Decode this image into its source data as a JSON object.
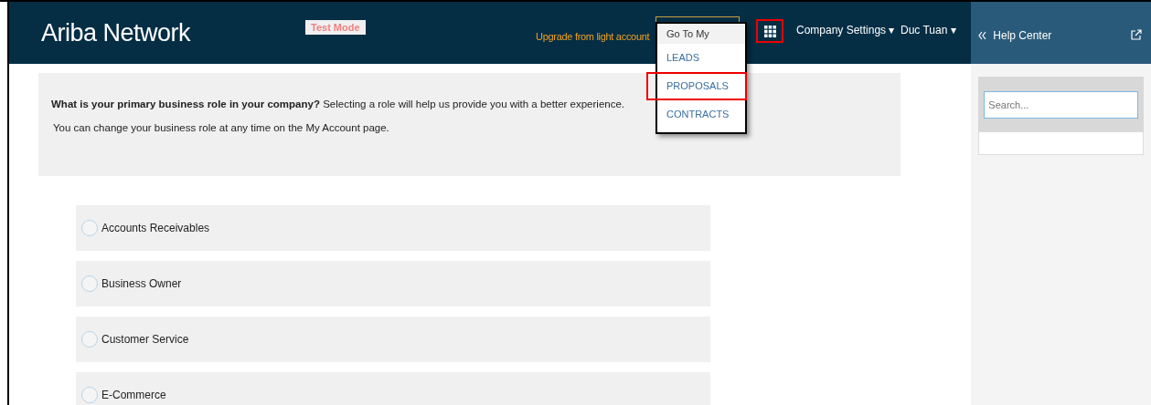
{
  "header": {
    "logo": "Ariba Network",
    "test_mode": "Test Mode",
    "upgrade_link": "Upgrade from light account",
    "apps_button": {
      "highlighted": true
    },
    "company_settings": "Company Settings ▾",
    "user_menu": "Duc Tuan ▾"
  },
  "go_to_menu": {
    "title": "Go To My",
    "items": [
      {
        "label": "LEADS",
        "highlighted": false
      },
      {
        "label": "PROPOSALS",
        "highlighted": true
      },
      {
        "label": "CONTRACTS",
        "highlighted": false
      }
    ]
  },
  "prompt": {
    "question": "**What is your primary business role in your company?** Selecting a role will help us provide you with a better experience.",
    "note": "You can change your business role at any time on the My Account page."
  },
  "roles": [
    {
      "label": "Accounts Receivables",
      "selected": false
    },
    {
      "label": "Business Owner",
      "selected": false
    },
    {
      "label": "Customer Service",
      "selected": false
    },
    {
      "label": "E-Commerce",
      "selected": false
    }
  ],
  "help_panel": {
    "title": "Help Center",
    "search": {
      "placeholder": "Search..."
    }
  }
}
